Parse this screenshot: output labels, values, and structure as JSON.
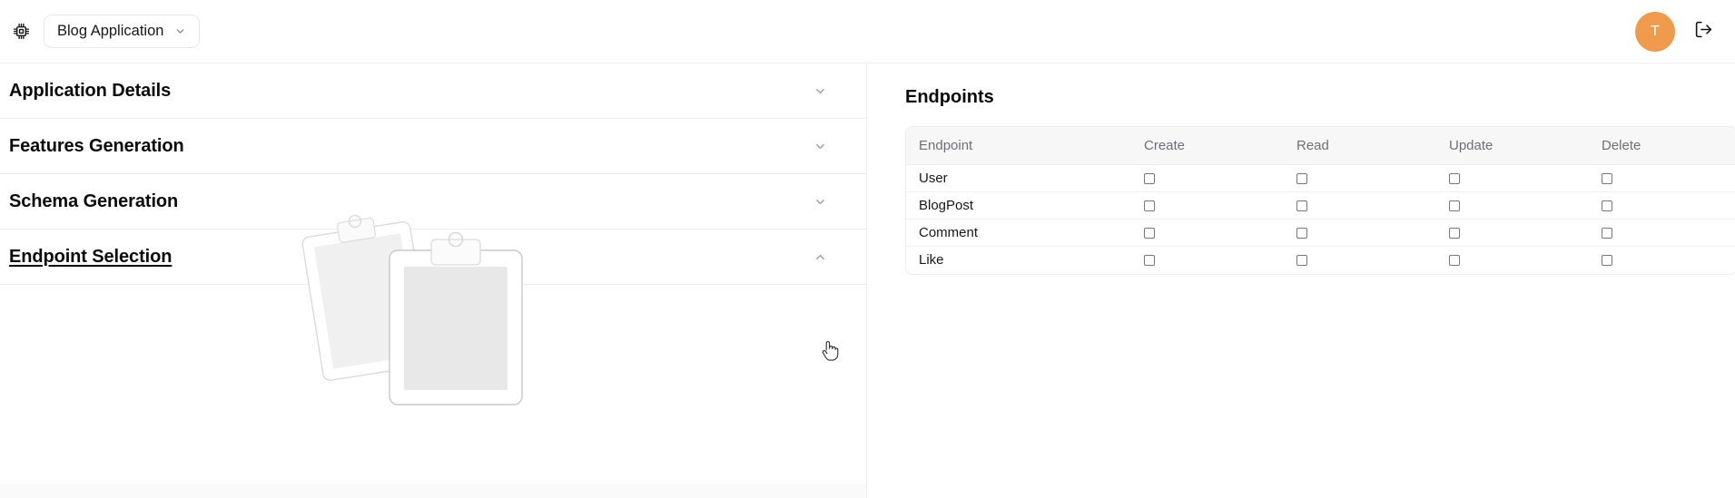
{
  "topbar": {
    "chip_icon": "chip-icon",
    "app_name": "Blog Application",
    "chevron_icon": "chevron-down-icon",
    "avatar_initial": "T",
    "avatar_color": "#ef9a4c",
    "logout_icon": "logout-icon"
  },
  "left_panel": {
    "sections": [
      {
        "label": "Application Details",
        "expanded": false,
        "chevron": "chevron-down-icon"
      },
      {
        "label": "Features Generation",
        "expanded": false,
        "chevron": "chevron-down-icon"
      },
      {
        "label": "Schema Generation",
        "expanded": false,
        "chevron": "chevron-down-icon"
      },
      {
        "label": "Endpoint Selection",
        "expanded": true,
        "chevron": "chevron-up-icon"
      }
    ],
    "empty_state_illustration": "clipboard-empty-state-illustration",
    "cursor": "hand-pointer-cursor"
  },
  "right_panel": {
    "title": "Endpoints",
    "table": {
      "columns": [
        "Endpoint",
        "Create",
        "Read",
        "Update",
        "Delete"
      ],
      "rows": [
        {
          "endpoint": "User",
          "create": false,
          "read": false,
          "update": false,
          "delete": false
        },
        {
          "endpoint": "BlogPost",
          "create": false,
          "read": false,
          "update": false,
          "delete": false
        },
        {
          "endpoint": "Comment",
          "create": false,
          "read": false,
          "update": false,
          "delete": false
        },
        {
          "endpoint": "Like",
          "create": false,
          "read": false,
          "update": false,
          "delete": false
        }
      ]
    }
  },
  "colors": {
    "accent_orange": "#ef9a4c",
    "border": "#ededef",
    "table_header_bg": "#f7f7f8",
    "muted_text": "#6e6e78"
  }
}
